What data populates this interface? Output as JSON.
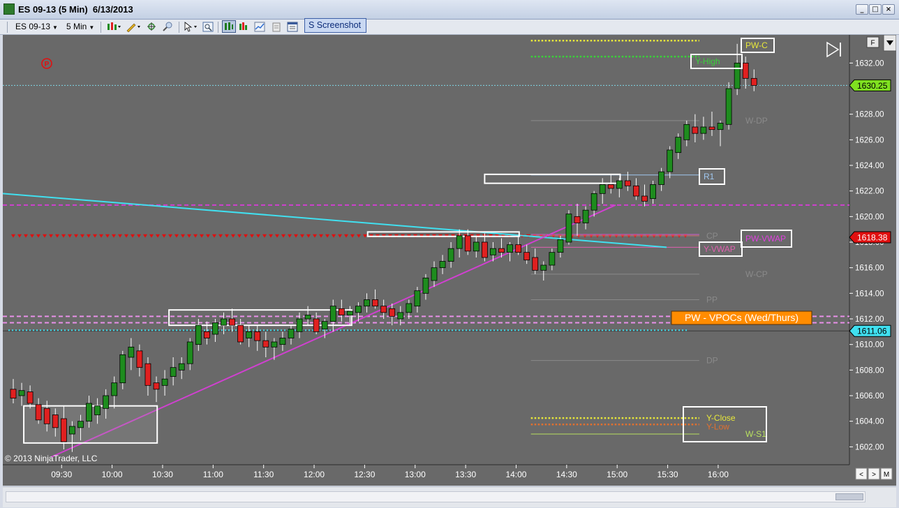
{
  "window": {
    "title": "ES 09-13 (5 Min)  6/13/2013",
    "controls": [
      "_",
      "□",
      "×"
    ]
  },
  "toolbar": {
    "instrument": "ES 09-13",
    "interval": "5 Min",
    "screenshot_label": "S Screenshot",
    "icons": [
      "bar-type-icon",
      "draw-tool-icon",
      "zoom-icon",
      "pointer-icon",
      "properties-icon",
      "data-box-icon",
      "indicators-icon",
      "strategies-icon",
      "template-icon"
    ]
  },
  "chart_panel": {
    "copyright": "© 2013 NinjaTrader, LLC",
    "p_marker": "P",
    "f_button": "F",
    "scroll_buttons": [
      "<",
      ">",
      "M"
    ],
    "last_price_label": "1630.25",
    "marker_label_red": "1618.38",
    "marker_label_cyan": "1611.06",
    "colors": {
      "background": "#696969",
      "up_candle": "#1e8c1e",
      "down_candle": "#e02020",
      "pw_c": "#e8e83a",
      "y_high": "#39d339",
      "magenta": "#d040d0",
      "cyan": "#40e0f0",
      "r1_line": "#a0c8f0",
      "y_vwap": "#e060b0",
      "vpoc_fill": "#ff8c00"
    }
  },
  "chart_data": {
    "type": "candlestick",
    "title": "ES 09-13 (5 Min)",
    "ylim": [
      1600.6,
      1634.2
    ],
    "y_ticks": [
      1602,
      1604,
      1606,
      1608,
      1610,
      1612,
      1614,
      1616,
      1618,
      1620,
      1622,
      1624,
      1626,
      1628,
      1632
    ],
    "y_tick_labels": [
      "1602.00",
      "1604.00",
      "1606.00",
      "1608.00",
      "1610.00",
      "1612.00",
      "1614.00",
      "1616.00",
      "1618.00",
      "1620.00",
      "1622.00",
      "1624.00",
      "1626.00",
      "1628.00",
      "1632.00"
    ],
    "x_tick_labels": [
      "09:30",
      "10:00",
      "10:30",
      "11:00",
      "11:30",
      "12:00",
      "12:30",
      "13:00",
      "13:30",
      "14:00",
      "14:30",
      "15:00",
      "15:30",
      "16:00"
    ],
    "x_tick_bars": [
      4,
      10,
      16,
      22,
      28,
      34,
      40,
      46,
      52,
      58,
      64,
      70,
      76,
      82
    ],
    "x_bar_range": [
      0,
      86
    ],
    "candles": [
      [
        1606.5,
        1607.3,
        1605.4,
        1605.8
      ],
      [
        1606.0,
        1607.0,
        1605.2,
        1606.4
      ],
      [
        1606.3,
        1606.8,
        1605.0,
        1605.4
      ],
      [
        1605.3,
        1605.8,
        1603.8,
        1604.1
      ],
      [
        1605.0,
        1605.6,
        1603.2,
        1603.8
      ],
      [
        1604.5,
        1605.0,
        1602.8,
        1603.5
      ],
      [
        1604.2,
        1605.2,
        1601.8,
        1602.4
      ],
      [
        1603.0,
        1604.0,
        1601.6,
        1603.6
      ],
      [
        1603.5,
        1604.5,
        1602.5,
        1604.0
      ],
      [
        1604.0,
        1606.0,
        1603.5,
        1605.4
      ],
      [
        1604.5,
        1605.8,
        1603.8,
        1605.2
      ],
      [
        1605.0,
        1606.5,
        1604.2,
        1606.0
      ],
      [
        1606.0,
        1607.5,
        1605.0,
        1607.0
      ],
      [
        1607.0,
        1609.5,
        1606.5,
        1609.2
      ],
      [
        1609.0,
        1610.5,
        1608.0,
        1609.8
      ],
      [
        1609.5,
        1610.0,
        1607.5,
        1608.2
      ],
      [
        1608.5,
        1609.0,
        1606.0,
        1606.8
      ],
      [
        1607.0,
        1607.5,
        1605.5,
        1606.5
      ],
      [
        1606.8,
        1608.0,
        1606.0,
        1607.3
      ],
      [
        1607.5,
        1609.0,
        1606.8,
        1608.2
      ],
      [
        1608.0,
        1609.0,
        1607.3,
        1608.5
      ],
      [
        1608.5,
        1610.5,
        1608.0,
        1610.2
      ],
      [
        1610.0,
        1612.0,
        1609.5,
        1611.5
      ],
      [
        1611.0,
        1611.8,
        1610.0,
        1610.5
      ],
      [
        1610.8,
        1612.0,
        1610.2,
        1611.7
      ],
      [
        1611.5,
        1612.5,
        1610.8,
        1612.0
      ],
      [
        1612.0,
        1612.8,
        1611.0,
        1611.5
      ],
      [
        1611.5,
        1612.0,
        1610.0,
        1610.2
      ],
      [
        1610.5,
        1611.5,
        1609.8,
        1611.0
      ],
      [
        1611.0,
        1611.5,
        1609.5,
        1610.3
      ],
      [
        1610.3,
        1611.0,
        1609.0,
        1609.8
      ],
      [
        1609.8,
        1610.5,
        1608.8,
        1610.2
      ],
      [
        1610.0,
        1611.0,
        1609.5,
        1610.5
      ],
      [
        1610.5,
        1611.5,
        1610.0,
        1611.2
      ],
      [
        1611.0,
        1612.5,
        1610.5,
        1612.0
      ],
      [
        1612.0,
        1613.0,
        1611.5,
        1612.3
      ],
      [
        1612.0,
        1612.5,
        1610.8,
        1611.0
      ],
      [
        1611.2,
        1612.0,
        1610.5,
        1611.8
      ],
      [
        1611.8,
        1613.5,
        1611.0,
        1613.0
      ],
      [
        1612.8,
        1613.5,
        1611.8,
        1612.3
      ],
      [
        1612.3,
        1613.0,
        1611.5,
        1612.6
      ],
      [
        1612.5,
        1613.3,
        1611.8,
        1613.0
      ],
      [
        1613.0,
        1614.0,
        1612.5,
        1613.5
      ],
      [
        1613.5,
        1614.3,
        1612.8,
        1613.0
      ],
      [
        1613.0,
        1613.5,
        1612.0,
        1612.5
      ],
      [
        1612.8,
        1613.2,
        1611.5,
        1612.2
      ],
      [
        1612.0,
        1613.0,
        1611.5,
        1612.5
      ],
      [
        1612.5,
        1613.5,
        1612.0,
        1613.2
      ],
      [
        1613.0,
        1614.5,
        1612.5,
        1614.2
      ],
      [
        1614.0,
        1615.5,
        1613.5,
        1615.2
      ],
      [
        1615.0,
        1616.5,
        1614.5,
        1616.0
      ],
      [
        1616.0,
        1617.0,
        1615.5,
        1616.5
      ],
      [
        1616.5,
        1618.0,
        1616.0,
        1617.5
      ],
      [
        1617.5,
        1619.0,
        1616.8,
        1618.5
      ],
      [
        1618.5,
        1619.0,
        1617.0,
        1617.3
      ],
      [
        1617.3,
        1618.5,
        1616.8,
        1618.0
      ],
      [
        1618.0,
        1618.7,
        1616.5,
        1616.8
      ],
      [
        1617.0,
        1618.0,
        1616.5,
        1617.5
      ],
      [
        1617.5,
        1618.3,
        1616.8,
        1617.2
      ],
      [
        1617.2,
        1618.0,
        1616.5,
        1617.8
      ],
      [
        1617.8,
        1618.5,
        1617.0,
        1617.2
      ],
      [
        1617.2,
        1617.8,
        1616.3,
        1616.6
      ],
      [
        1616.8,
        1617.5,
        1615.5,
        1615.8
      ],
      [
        1615.8,
        1616.5,
        1615.0,
        1616.2
      ],
      [
        1616.2,
        1617.5,
        1615.8,
        1617.2
      ],
      [
        1617.2,
        1618.5,
        1616.8,
        1618.2
      ],
      [
        1618.0,
        1620.5,
        1617.8,
        1620.2
      ],
      [
        1620.0,
        1621.0,
        1618.5,
        1619.5
      ],
      [
        1619.5,
        1620.8,
        1619.0,
        1620.5
      ],
      [
        1620.5,
        1622.0,
        1620.0,
        1621.8
      ],
      [
        1621.8,
        1623.0,
        1621.0,
        1622.5
      ],
      [
        1622.5,
        1623.3,
        1621.8,
        1622.2
      ],
      [
        1622.2,
        1623.0,
        1621.5,
        1622.8
      ],
      [
        1622.8,
        1623.5,
        1622.0,
        1622.4
      ],
      [
        1622.4,
        1623.0,
        1621.3,
        1621.6
      ],
      [
        1621.6,
        1622.5,
        1620.8,
        1621.2
      ],
      [
        1621.4,
        1622.8,
        1621.0,
        1622.5
      ],
      [
        1622.5,
        1623.8,
        1622.0,
        1623.5
      ],
      [
        1623.5,
        1625.5,
        1623.0,
        1625.2
      ],
      [
        1625.0,
        1626.5,
        1624.5,
        1626.2
      ],
      [
        1626.0,
        1627.5,
        1625.5,
        1627.2
      ],
      [
        1627.0,
        1628.0,
        1625.8,
        1626.5
      ],
      [
        1626.5,
        1627.8,
        1626.0,
        1627.0
      ],
      [
        1627.0,
        1628.2,
        1626.3,
        1626.8
      ],
      [
        1626.8,
        1627.5,
        1625.5,
        1627.3
      ],
      [
        1627.2,
        1630.5,
        1626.8,
        1630.0
      ],
      [
        1630.0,
        1633.5,
        1629.5,
        1632.0
      ],
      [
        1632.0,
        1632.5,
        1630.0,
        1630.8
      ],
      [
        1630.8,
        1631.5,
        1629.8,
        1630.25
      ]
    ],
    "horizontal_levels": [
      {
        "name": "PW-C",
        "price": 1633.75,
        "color": "#e8e83a",
        "style": "dotted"
      },
      {
        "name": "Y-High",
        "price": 1632.5,
        "color": "#39d339",
        "style": "dotted"
      },
      {
        "name": "W-DP",
        "price": 1627.5,
        "color": "#8a8a8a",
        "style": "thin"
      },
      {
        "name": "R1",
        "price": 1623.25,
        "color": "#a0c8f0",
        "style": "thin"
      },
      {
        "name": "CP",
        "price": 1618.5,
        "color": "#d07070",
        "style": "thin"
      },
      {
        "name": "PW-VWAP",
        "price": 1618.6,
        "color": "#d060d0",
        "style": "thin"
      },
      {
        "name": "Y-VWAP",
        "price": 1617.6,
        "color": "#e060b0",
        "style": "thin"
      },
      {
        "name": "W-CP",
        "price": 1615.5,
        "color": "#8a8a8a",
        "style": "thin"
      },
      {
        "name": "PP",
        "price": 1613.5,
        "color": "#8a8a8a",
        "style": "thin"
      },
      {
        "name": "DP",
        "price": 1608.75,
        "color": "#8a8a8a",
        "style": "thin"
      },
      {
        "name": "Y-Close",
        "price": 1604.25,
        "color": "#e8e83a",
        "style": "dotted"
      },
      {
        "name": "Y-Low",
        "price": 1603.75,
        "color": "#e07030",
        "style": "dotted"
      },
      {
        "name": "W-S1",
        "price": 1603.0,
        "color": "#b8e060",
        "style": "thin"
      }
    ],
    "annotations": {
      "vpoc_label": "PW - VPOCs (Wed/Thurs)",
      "labels": [
        "PW-C",
        "Y-High",
        "W-DP",
        "R1",
        "CP",
        "PW-VWAP",
        "Y-VWAP",
        "W-CP",
        "PP",
        "DP",
        "Y-Close",
        "Y-Low",
        "W-S1"
      ]
    },
    "grid": false,
    "legend": "none"
  }
}
